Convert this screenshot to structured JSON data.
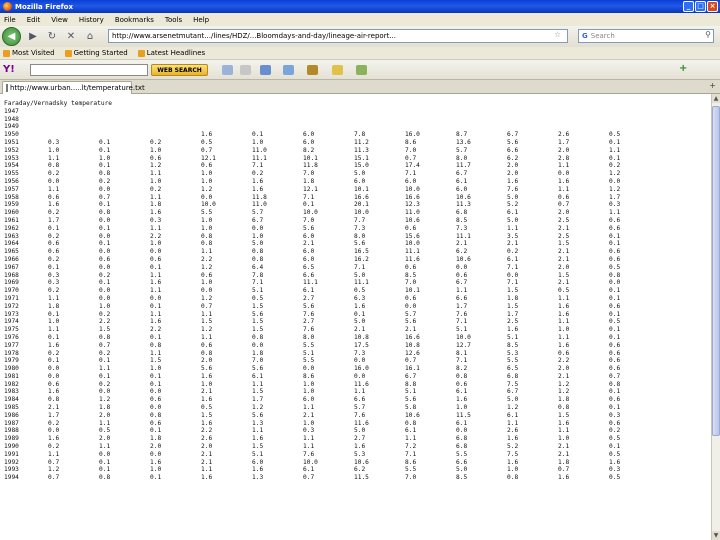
{
  "window": {
    "title": "Mozilla Firefox",
    "min": "_",
    "max": "□",
    "close": "×"
  },
  "menu": [
    "File",
    "Edit",
    "View",
    "History",
    "Bookmarks",
    "Tools",
    "Help"
  ],
  "nav": {
    "back": "◀",
    "forward": "▶",
    "reload": "↻",
    "stop": "✕",
    "home": "⌂",
    "url": "http://www.arsenetmutant.../lines/HDZ/...Bloomdays-and-day/lineage-air-report...",
    "search_placeholder": "Search"
  },
  "bookmarks": [
    {
      "label": "Most Visited"
    },
    {
      "label": "Getting Started"
    },
    {
      "label": "Latest Headlines"
    }
  ],
  "yahoo": {
    "logo": "Y!",
    "button": "WEB SEARCH"
  },
  "tab": {
    "title": "http://www.urban.....lt/temperature.txt",
    "new": "+"
  },
  "content": {
    "header": "Faraday/Vernadsky temperature",
    "empty_years": [
      "1947",
      "1948",
      "1949"
    ],
    "rows": [
      [
        "1950",
        "",
        "",
        "",
        "1.6",
        "0.1",
        "6.0",
        "7.8",
        "16.0",
        "8.7",
        "6.7",
        "2.6",
        "0.5"
      ],
      [
        "1951",
        "0.3",
        "0.1",
        "0.2",
        "0.5",
        "1.0",
        "6.0",
        "11.2",
        "8.6",
        "13.6",
        "5.6",
        "1.7",
        "0.1"
      ],
      [
        "1952",
        "1.0",
        "0.1",
        "1.0",
        "0.7",
        "11.0",
        "8.2",
        "11.3",
        "7.0",
        "5.7",
        "6.6",
        "2.0",
        "1.1"
      ],
      [
        "1953",
        "1.1",
        "1.0",
        "0.6",
        "12.1",
        "11.1",
        "10.1",
        "15.1",
        "0.7",
        "8.0",
        "6.2",
        "2.8",
        "0.1"
      ],
      [
        "1954",
        "0.8",
        "0.1",
        "1.2",
        "0.6",
        "7.1",
        "11.8",
        "15.0",
        "17.4",
        "11.7",
        "2.0",
        "1.1",
        "0.2"
      ],
      [
        "1955",
        "0.2",
        "0.8",
        "1.1",
        "1.0",
        "0.2",
        "7.0",
        "5.0",
        "7.1",
        "6.7",
        "2.0",
        "0.0",
        "1.2"
      ],
      [
        "1956",
        "0.0",
        "0.2",
        "1.0",
        "1.0",
        "1.6",
        "1.8",
        "6.0",
        "6.0",
        "6.1",
        "1.6",
        "1.6",
        "0.0"
      ],
      [
        "1957",
        "1.1",
        "0.0",
        "0.2",
        "1.2",
        "1.6",
        "12.1",
        "10.1",
        "10.0",
        "6.0",
        "7.6",
        "1.1",
        "1.2"
      ],
      [
        "1958",
        "0.6",
        "0.7",
        "1.1",
        "0.0",
        "11.8",
        "7.1",
        "16.6",
        "16.6",
        "10.6",
        "5.0",
        "0.6",
        "1.7"
      ],
      [
        "1959",
        "1.6",
        "0.1",
        "1.8",
        "10.0",
        "11.0",
        "0.1",
        "20.1",
        "12.3",
        "11.3",
        "5.2",
        "0.7",
        "0.3"
      ],
      [
        "1960",
        "0.2",
        "0.8",
        "1.6",
        "5.5",
        "5.7",
        "10.0",
        "10.0",
        "11.0",
        "6.8",
        "6.1",
        "2.0",
        "1.1"
      ],
      [
        "1961",
        "1.7",
        "0.0",
        "0.3",
        "1.0",
        "6.7",
        "7.0",
        "7.7",
        "10.6",
        "8.5",
        "5.0",
        "2.5",
        "0.6"
      ],
      [
        "1962",
        "0.1",
        "0.1",
        "1.1",
        "1.0",
        "0.0",
        "5.6",
        "7.3",
        "0.6",
        "7.3",
        "1.1",
        "2.1",
        "0.6"
      ],
      [
        "1963",
        "0.2",
        "0.0",
        "2.2",
        "0.8",
        "1.0",
        "6.0",
        "8.0",
        "15.6",
        "11.1",
        "3.5",
        "2.5",
        "0.1"
      ],
      [
        "1964",
        "0.6",
        "0.1",
        "1.0",
        "0.8",
        "5.0",
        "2.1",
        "5.6",
        "10.0",
        "2.1",
        "2.1",
        "1.5",
        "0.1"
      ],
      [
        "1965",
        "0.6",
        "0.0",
        "0.0",
        "1.1",
        "0.8",
        "6.0",
        "16.5",
        "11.1",
        "6.2",
        "0.2",
        "2.1",
        "0.6"
      ],
      [
        "1966",
        "0.2",
        "0.6",
        "0.6",
        "2.2",
        "0.8",
        "6.0",
        "16.2",
        "11.6",
        "10.6",
        "6.1",
        "2.1",
        "0.6"
      ],
      [
        "1967",
        "0.1",
        "0.0",
        "0.1",
        "1.2",
        "6.4",
        "6.5",
        "7.1",
        "0.6",
        "0.0",
        "7.1",
        "2.0",
        "0.5"
      ],
      [
        "1968",
        "0.3",
        "0.2",
        "1.1",
        "0.6",
        "7.8",
        "6.6",
        "5.0",
        "8.5",
        "0.6",
        "0.0",
        "1.5",
        "0.8"
      ],
      [
        "1969",
        "0.3",
        "0.1",
        "1.6",
        "1.0",
        "7.1",
        "11.1",
        "11.1",
        "7.0",
        "6.7",
        "7.1",
        "2.1",
        "0.0"
      ],
      [
        "1970",
        "0.2",
        "0.0",
        "1.1",
        "0.0",
        "5.1",
        "6.1",
        "0.5",
        "10.1",
        "1.1",
        "1.5",
        "0.5",
        "0.1"
      ],
      [
        "1971",
        "1.1",
        "0.0",
        "0.0",
        "1.2",
        "0.5",
        "2.7",
        "6.3",
        "0.6",
        "6.6",
        "1.8",
        "1.1",
        "0.1"
      ],
      [
        "1972",
        "1.8",
        "1.0",
        "0.1",
        "0.7",
        "1.5",
        "5.6",
        "1.6",
        "0.0",
        "1.7",
        "1.5",
        "1.6",
        "0.6"
      ],
      [
        "1973",
        "0.1",
        "0.2",
        "1.1",
        "1.1",
        "5.6",
        "7.6",
        "0.1",
        "5.7",
        "7.6",
        "1.7",
        "1.6",
        "0.1"
      ],
      [
        "1974",
        "1.0",
        "2.2",
        "1.6",
        "1.5",
        "1.5",
        "2.7",
        "5.0",
        "5.6",
        "7.1",
        "2.5",
        "1.1",
        "0.5"
      ],
      [
        "1975",
        "1.1",
        "1.5",
        "2.2",
        "1.2",
        "1.5",
        "7.6",
        "2.1",
        "2.1",
        "5.1",
        "1.6",
        "1.0",
        "0.1"
      ],
      [
        "1976",
        "0.1",
        "0.8",
        "0.1",
        "1.1",
        "0.8",
        "8.0",
        "10.8",
        "16.6",
        "10.0",
        "5.1",
        "1.1",
        "0.1"
      ],
      [
        "1977",
        "1.6",
        "0.7",
        "0.8",
        "0.6",
        "0.0",
        "5.5",
        "17.5",
        "10.8",
        "12.7",
        "8.5",
        "1.6",
        "0.6"
      ],
      [
        "1978",
        "0.2",
        "0.2",
        "1.1",
        "0.8",
        "1.8",
        "5.1",
        "7.3",
        "12.6",
        "8.1",
        "5.3",
        "0.6",
        "0.6"
      ],
      [
        "1979",
        "0.1",
        "0.1",
        "1.5",
        "2.0",
        "7.0",
        "5.5",
        "0.0",
        "0.7",
        "7.1",
        "5.5",
        "2.2",
        "0.6"
      ],
      [
        "1980",
        "0.0",
        "1.1",
        "1.0",
        "5.6",
        "5.6",
        "0.0",
        "16.0",
        "16.1",
        "8.2",
        "6.5",
        "2.0",
        "0.6"
      ],
      [
        "1981",
        "0.0",
        "0.1",
        "0.1",
        "1.6",
        "6.1",
        "8.6",
        "0.0",
        "6.7",
        "0.8",
        "6.8",
        "2.1",
        "0.7"
      ],
      [
        "1982",
        "0.6",
        "0.2",
        "0.1",
        "1.0",
        "1.1",
        "1.0",
        "11.6",
        "8.8",
        "0.6",
        "7.5",
        "1.2",
        "0.8"
      ],
      [
        "1983",
        "1.6",
        "0.0",
        "0.0",
        "2.1",
        "1.5",
        "1.0",
        "1.1",
        "5.1",
        "6.1",
        "6.7",
        "1.2",
        "0.1"
      ],
      [
        "1984",
        "0.8",
        "1.2",
        "0.6",
        "1.6",
        "1.7",
        "6.0",
        "6.6",
        "5.6",
        "1.6",
        "5.0",
        "1.8",
        "0.6"
      ],
      [
        "1985",
        "2.1",
        "1.8",
        "0.0",
        "0.5",
        "1.2",
        "1.1",
        "5.7",
        "5.8",
        "1.0",
        "1.2",
        "0.8",
        "0.1"
      ],
      [
        "1986",
        "1.7",
        "2.0",
        "0.8",
        "1.5",
        "5.6",
        "2.1",
        "7.6",
        "10.6",
        "11.5",
        "6.1",
        "1.5",
        "0.3"
      ],
      [
        "1987",
        "0.2",
        "1.1",
        "0.6",
        "1.6",
        "1.3",
        "1.0",
        "11.6",
        "0.8",
        "6.1",
        "1.1",
        "1.6",
        "0.6"
      ],
      [
        "1988",
        "0.0",
        "0.5",
        "0.1",
        "2.2",
        "1.1",
        "0.3",
        "5.0",
        "6.1",
        "0.0",
        "2.6",
        "1.1",
        "0.2"
      ],
      [
        "1989",
        "1.6",
        "2.0",
        "1.8",
        "2.6",
        "1.6",
        "1.1",
        "2.7",
        "1.1",
        "6.8",
        "1.6",
        "1.0",
        "0.5"
      ],
      [
        "1990",
        "0.2",
        "1.1",
        "2.0",
        "2.0",
        "1.5",
        "1.1",
        "1.6",
        "7.2",
        "6.8",
        "5.2",
        "2.1",
        "0.1"
      ],
      [
        "1991",
        "1.1",
        "0.0",
        "0.0",
        "2.1",
        "5.1",
        "7.6",
        "5.3",
        "7.1",
        "5.5",
        "7.5",
        "2.1",
        "0.5"
      ],
      [
        "1992",
        "0.7",
        "0.1",
        "1.6",
        "2.1",
        "6.0",
        "10.0",
        "10.6",
        "8.6",
        "6.6",
        "1.6",
        "1.8",
        "1.6"
      ],
      [
        "1993",
        "1.2",
        "0.1",
        "1.0",
        "1.1",
        "1.6",
        "6.1",
        "6.2",
        "5.5",
        "5.0",
        "1.0",
        "0.7",
        "0.3"
      ],
      [
        "1994",
        "0.7",
        "0.8",
        "0.1",
        "1.6",
        "1.3",
        "0.7",
        "11.5",
        "7.0",
        "8.5",
        "0.8",
        "1.6",
        "0.5"
      ]
    ]
  }
}
